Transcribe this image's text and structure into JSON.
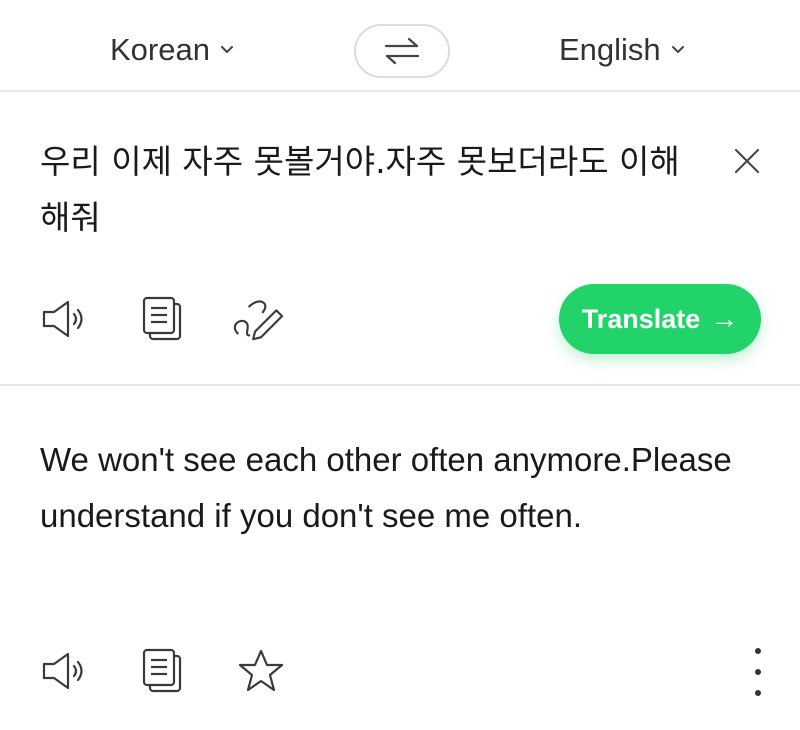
{
  "colors": {
    "accent": "#22d36a",
    "icon": "#3a3a3a",
    "divider": "#e6e6e6"
  },
  "language_bar": {
    "source_language": "Korean",
    "target_language": "English",
    "swap_icon": "swap-arrows-icon",
    "dropdown_icon": "chevron-down-icon"
  },
  "source": {
    "text": "우리 이제 자주 못볼거야.자주 못보더라도 이해해줘",
    "clear_icon": "close-icon",
    "actions": [
      "speaker-icon",
      "copy-icon",
      "handwriting-icon"
    ]
  },
  "translate_button": {
    "label": "Translate",
    "arrow": "→"
  },
  "result": {
    "text": "We won't see each other often anymore.Please understand if you don't see me often.",
    "actions": [
      "speaker-icon",
      "copy-icon",
      "star-icon",
      "more-vertical-icon"
    ]
  }
}
